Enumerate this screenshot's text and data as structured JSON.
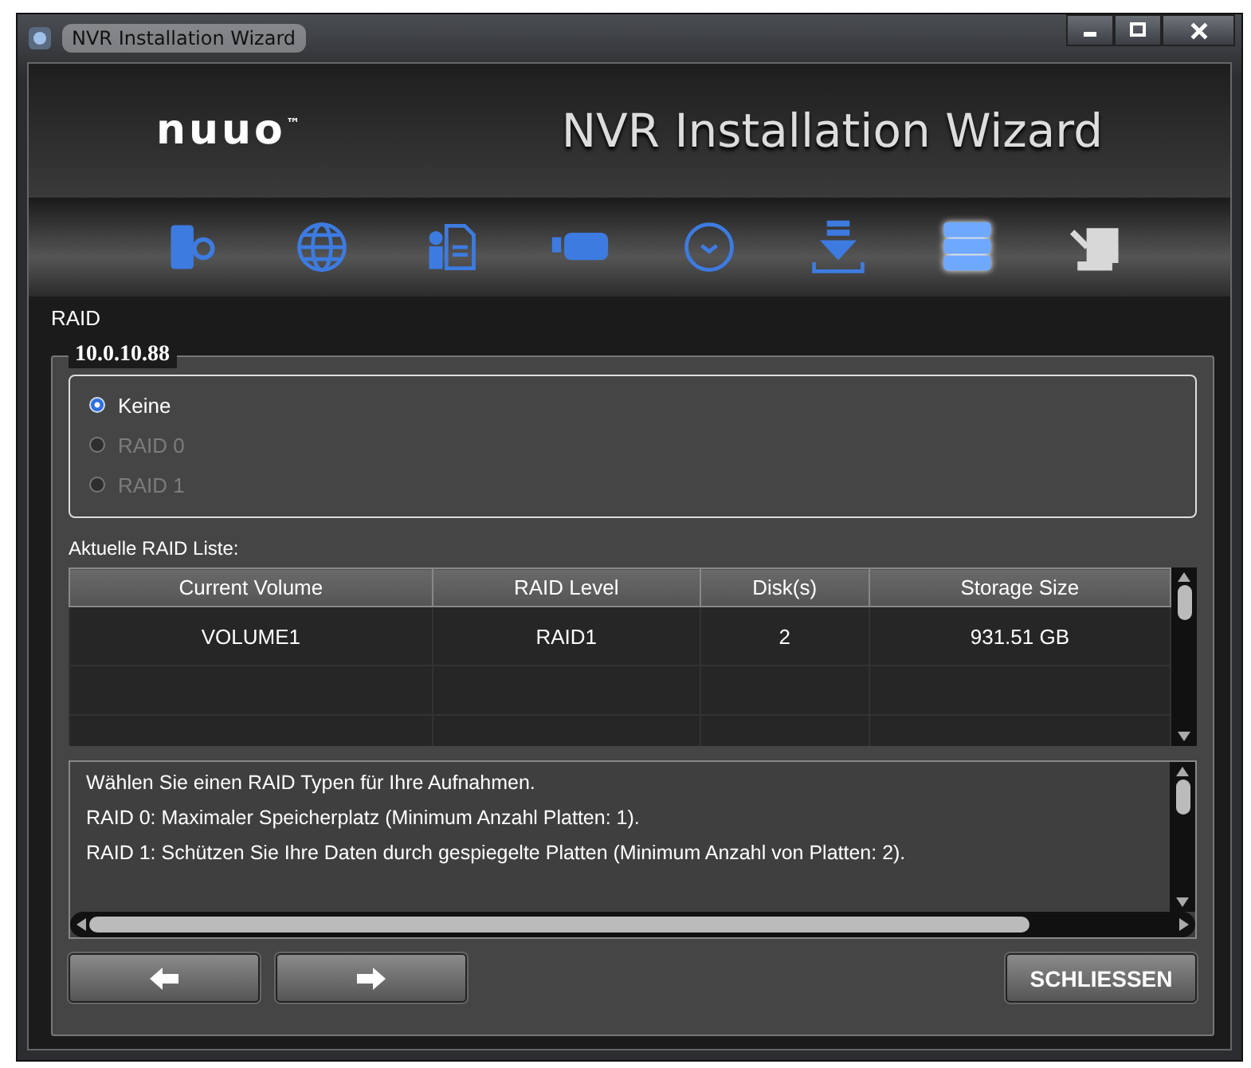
{
  "window": {
    "title": "NVR Installation Wizard"
  },
  "header": {
    "logo": "nuuo",
    "logo_mark": "™",
    "title": "NVR Installation Wizard"
  },
  "steps": [
    {
      "selected": false,
      "disabled": false
    },
    {
      "selected": false,
      "disabled": false
    },
    {
      "selected": false,
      "disabled": false
    },
    {
      "selected": false,
      "disabled": false
    },
    {
      "selected": false,
      "disabled": false
    },
    {
      "selected": false,
      "disabled": false
    },
    {
      "selected": true,
      "disabled": false
    },
    {
      "selected": false,
      "disabled": true
    }
  ],
  "section_title": "RAID",
  "group": {
    "title": "10.0.10.88"
  },
  "raid_options": [
    {
      "label": "Keine",
      "selected": true,
      "disabled": false
    },
    {
      "label": "RAID 0",
      "selected": false,
      "disabled": true
    },
    {
      "label": "RAID 1",
      "selected": false,
      "disabled": true
    }
  ],
  "list_label": "Aktuelle RAID Liste:",
  "table": {
    "columns": [
      "Current Volume",
      "RAID Level",
      "Disk(s)",
      "Storage Size"
    ],
    "rows": [
      [
        "VOLUME1",
        "RAID1",
        "2",
        "931.51 GB"
      ]
    ]
  },
  "description": [
    "Wählen Sie einen RAID Typen für Ihre Aufnahmen.",
    "RAID 0: Maximaler Speicherplatz (Minimum Anzahl Platten: 1).",
    "RAID 1: Schützen Sie Ihre Daten durch gespiegelte Platten (Minimum Anzahl von Platten: 2)."
  ],
  "close_button": "SCHLIESSEN"
}
